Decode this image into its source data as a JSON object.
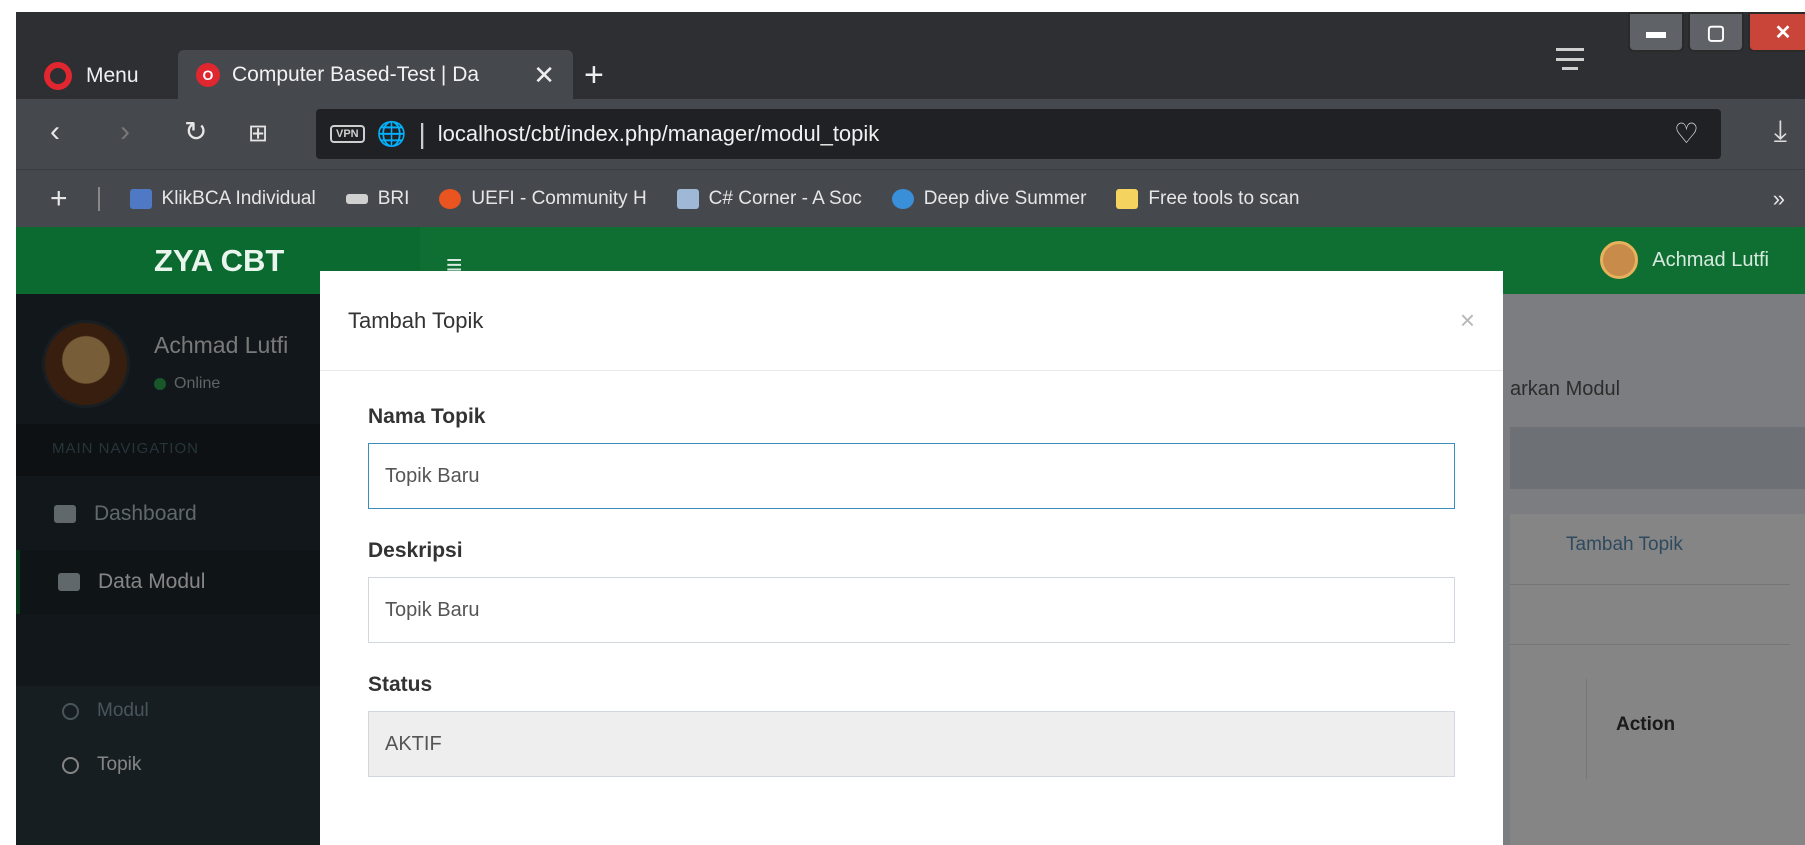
{
  "browser": {
    "menu_label": "Menu",
    "tab_title": "Computer Based-Test | Da",
    "url": "localhost/cbt/index.php/manager/modul_topik",
    "vpn_badge": "VPN",
    "bookmarks": [
      "KlikBCA Individual",
      "BRI",
      "UEFI - Community H",
      "C# Corner - A Soc",
      "Deep dive Summer",
      "Free tools to scan"
    ]
  },
  "app": {
    "brand": "ZYA CBT",
    "header_user": "Achmad Lutfi",
    "sidebar": {
      "user_name": "Achmad Lutfi",
      "user_status": "Online",
      "section_header": "MAIN NAVIGATION",
      "items": [
        {
          "label": "Dashboard"
        },
        {
          "label": "Data Modul"
        }
      ],
      "sub_items": [
        {
          "label": "Modul"
        },
        {
          "label": "Topik"
        }
      ]
    },
    "background": {
      "description_fragment": "arkan Modul",
      "add_link": "Tambah Topik",
      "action_header": "Action"
    }
  },
  "modal": {
    "title": "Tambah Topik",
    "close_symbol": "×",
    "fields": {
      "name_label": "Nama Topik",
      "name_value": "Topik Baru",
      "desc_label": "Deskripsi",
      "desc_value": "Topik Baru",
      "status_label": "Status",
      "status_value": "AKTIF"
    }
  },
  "colors": {
    "header_green": "#0f6f33",
    "sidebar_dark": "#222d32",
    "focus_blue": "#3c8dbc"
  }
}
